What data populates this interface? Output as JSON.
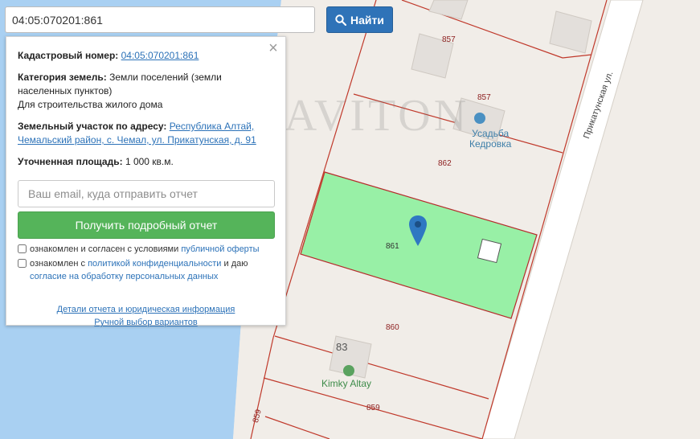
{
  "search": {
    "value": "04:05:070201:861",
    "button_label": "Найти"
  },
  "panel": {
    "cadastral_label": "Кадастровый номер:",
    "cadastral_value": "04:05:070201:861",
    "category_label": "Категория земель:",
    "category_value": "Земли поселений (земли населенных пунктов)",
    "usage": "Для строительства жилого дома",
    "address_label": "Земельный участок по адресу:",
    "address_value": "Республика Алтай, Чемальский район, с. Чемал, ул. Прикатунская, д. 91",
    "area_label": "Уточненная площадь:",
    "area_value": "1 000 кв.м.",
    "email_placeholder": "Ваш email, куда отправить отчет",
    "report_button": "Получить подробный отчет",
    "consent1_text": "ознакомлен и согласен с условиями",
    "consent1_link": "публичной оферты",
    "consent2_text_a": "ознакомлен с",
    "consent2_link_a": "политикой конфиденциальности",
    "consent2_text_b": "и даю",
    "consent2_link_b": "согласие на обработку персональных данных",
    "details_link": "Детали отчета и юридическая информация",
    "manual_link": "Ручной выбор вариантов"
  },
  "map": {
    "watermark": "GRAVITON",
    "parcel_labels": [
      "857",
      "857",
      "862",
      "861",
      "860",
      "859",
      "859"
    ],
    "street_name": "Прикатунская ул.",
    "poi_hotel_line1": "Усадьба",
    "poi_hotel_line2": "Кедровка",
    "poi_shop": "Kimky Altay",
    "building_number": "83",
    "colors": {
      "selected_parcel": "#98f0a6",
      "boundary": "#c0392b",
      "water": "#a9d0f2",
      "road": "#ffffff"
    }
  }
}
